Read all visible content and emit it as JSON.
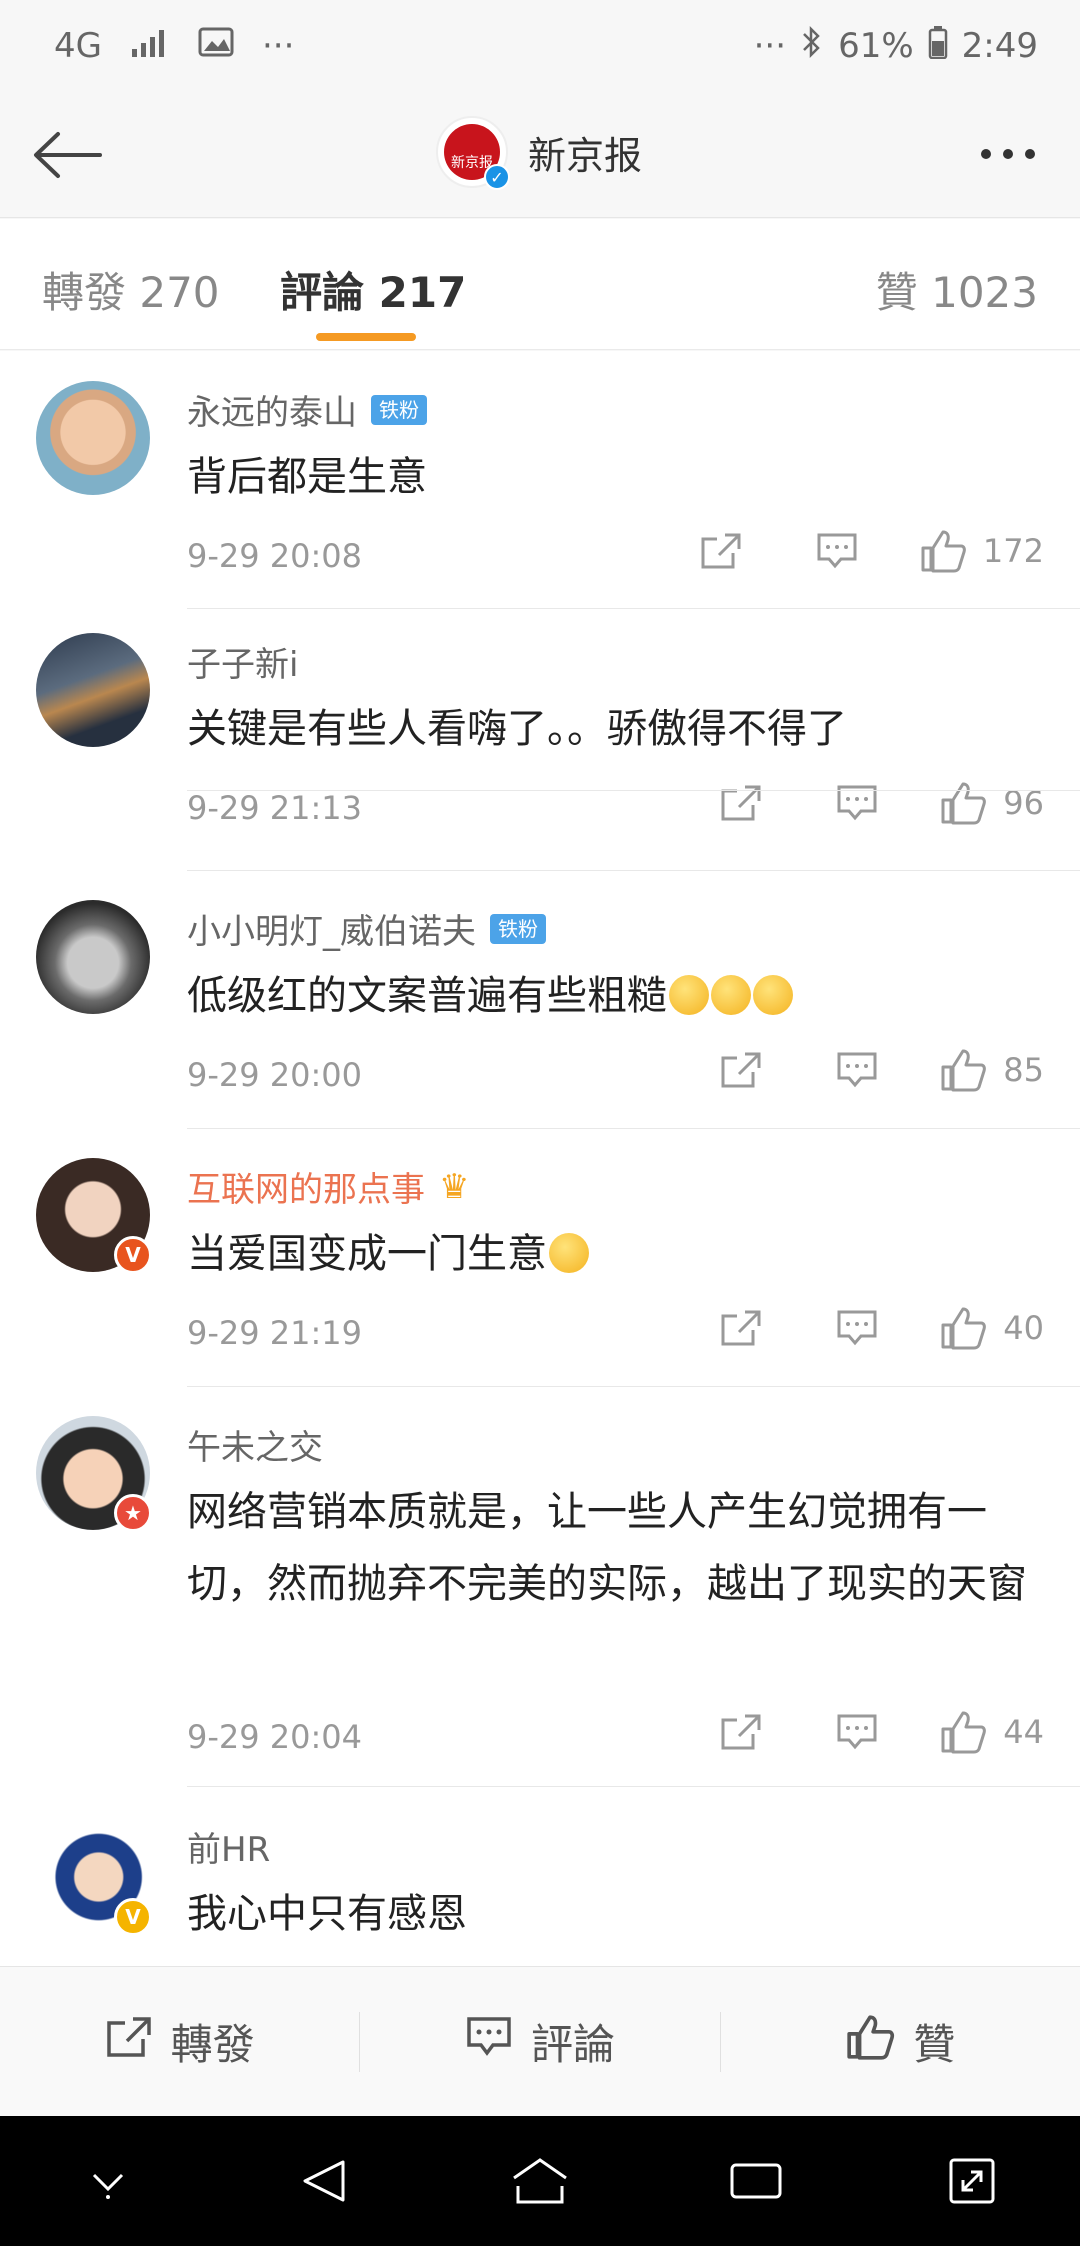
{
  "status": {
    "network": "4G",
    "overflow_left": "···",
    "overflow_right": "···",
    "battery": "61%",
    "time": "2:49"
  },
  "nav": {
    "logo_text": "新京报",
    "title": "新京报"
  },
  "tabs": {
    "repost": "轉發 270",
    "comments": "評論 217",
    "likes": "贊 1023",
    "accent": "#f59a23"
  },
  "comments": [
    {
      "name": "永远的泰山",
      "badge": "铁粉",
      "text": "背后都是生意",
      "time": "9-29 20:08",
      "likes": "172"
    },
    {
      "name": "子子新i",
      "badge": "",
      "text": "关键是有些人看嗨了。。骄傲得不得了",
      "time": "9-29 21:13",
      "likes": "96"
    },
    {
      "name": "小小明灯_威伯诺夫",
      "badge": "铁粉",
      "text": "低级红的文案普遍有些粗糙",
      "time": "9-29 20:00",
      "likes": "85"
    },
    {
      "name": "互联网的那点事",
      "badge": "",
      "text": "当爱国变成一门生意",
      "time": "9-29 21:19",
      "likes": "40"
    },
    {
      "name": "午未之交",
      "badge": "",
      "text": "网络营销本质就是，让一些人产生幻觉拥有一切，然而抛弃不完美的实际，越出了现实的天窗",
      "time": "9-29 20:04",
      "likes": "44"
    },
    {
      "name": "前HR",
      "badge": "",
      "text": "我心中只有感恩",
      "time": "",
      "likes": ""
    }
  ],
  "bottom_bar": {
    "repost": "轉發",
    "comment": "評論",
    "like": "贊"
  }
}
